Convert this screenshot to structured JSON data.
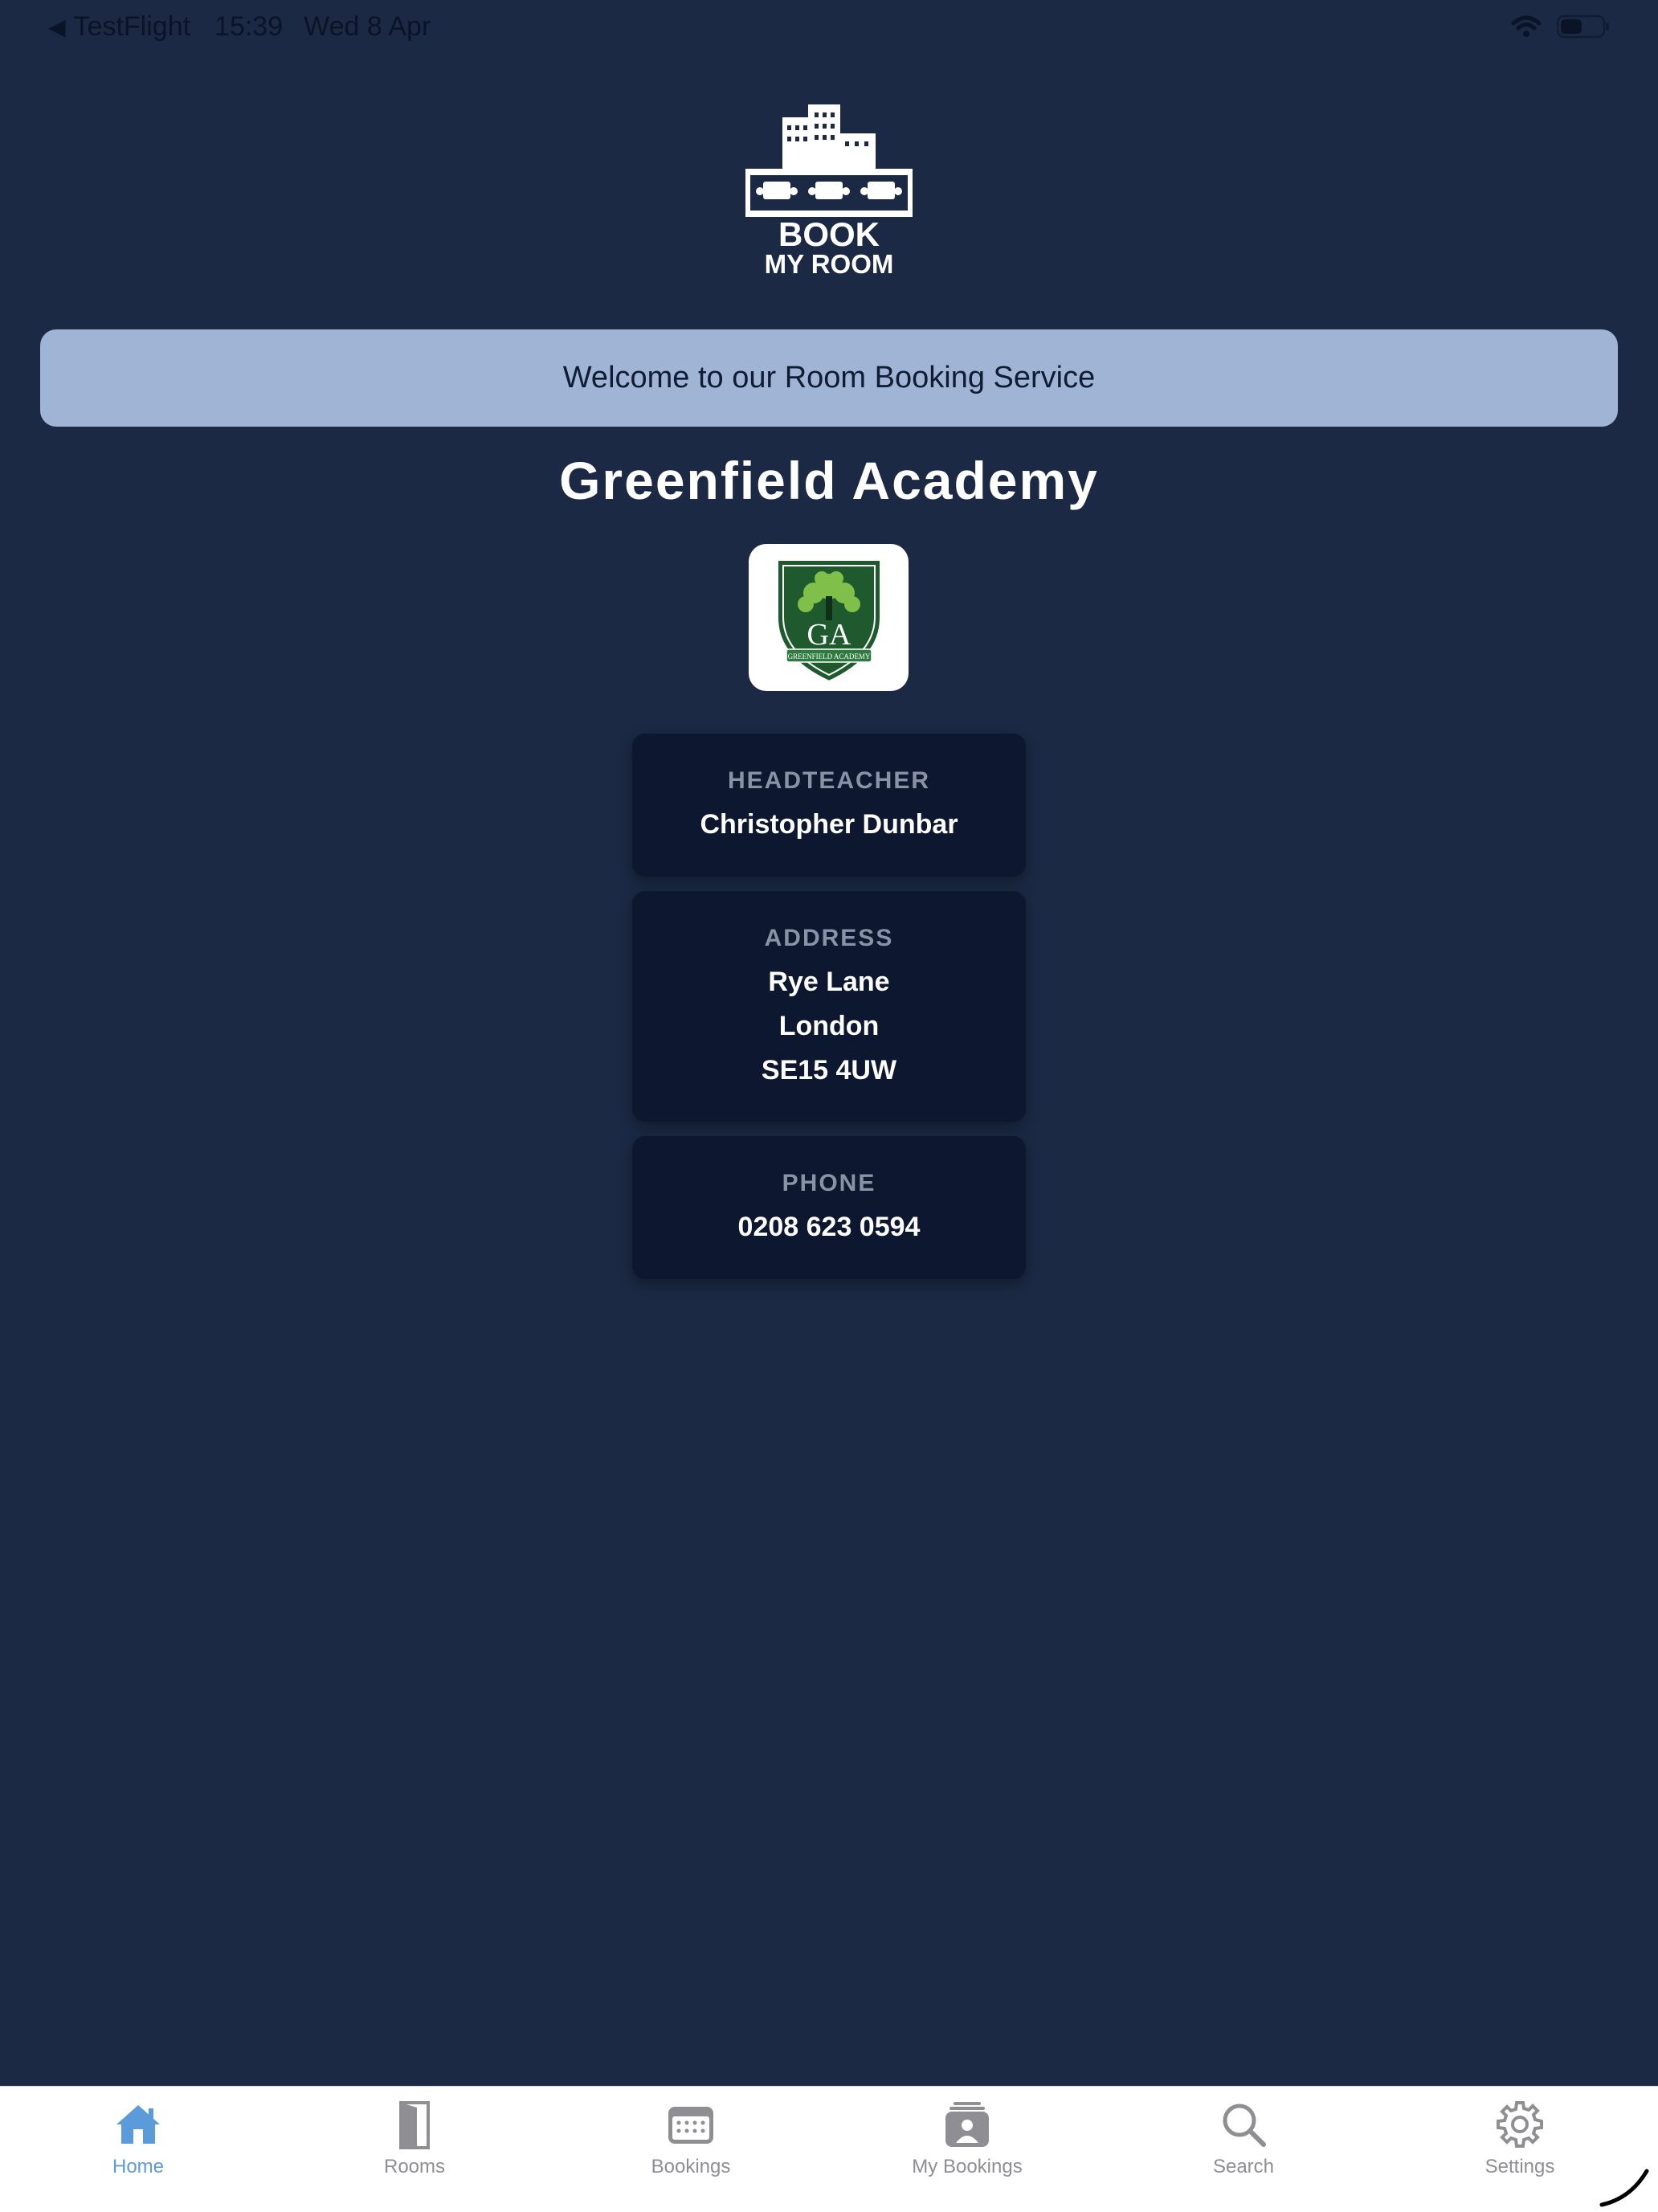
{
  "status_bar": {
    "back_arrow": "◀",
    "back_app": "TestFlight",
    "time": "15:39",
    "date": "Wed 8 Apr",
    "icons": [
      "wifi-icon",
      "battery-icon"
    ]
  },
  "logo": {
    "line1": "BOOK",
    "line2": "MY ROOM"
  },
  "welcome": {
    "text": "Welcome to our Room Booking Service"
  },
  "school": {
    "name": "Greenfield Academy",
    "crest": {
      "initials": "GA",
      "banner": "GREENFIELD ACADEMY"
    }
  },
  "info_cards": {
    "headteacher": {
      "label": "HEADTEACHER",
      "value": "Christopher Dunbar"
    },
    "address": {
      "label": "ADDRESS",
      "lines": [
        "Rye Lane",
        "London",
        "SE15 4UW"
      ]
    },
    "phone": {
      "label": "PHONE",
      "value": "0208 623 0594"
    }
  },
  "tab_bar": {
    "tabs": [
      {
        "label": "Home",
        "icon": "house-icon",
        "active": true
      },
      {
        "label": "Rooms",
        "icon": "door-icon",
        "active": false
      },
      {
        "label": "Bookings",
        "icon": "calendar-icon",
        "active": false
      },
      {
        "label": "My Bookings",
        "icon": "person-calendar-icon",
        "active": false
      },
      {
        "label": "Search",
        "icon": "magnifier-icon",
        "active": false
      },
      {
        "label": "Settings",
        "icon": "gear-icon",
        "active": false
      }
    ]
  },
  "colors": {
    "background": "#1b2944",
    "banner": "#a0b5d5",
    "card": "#0d1730",
    "active_tab": "#5b9bd9",
    "inactive_tab": "#8e8e93",
    "crest_green": "#1f5a2e"
  }
}
